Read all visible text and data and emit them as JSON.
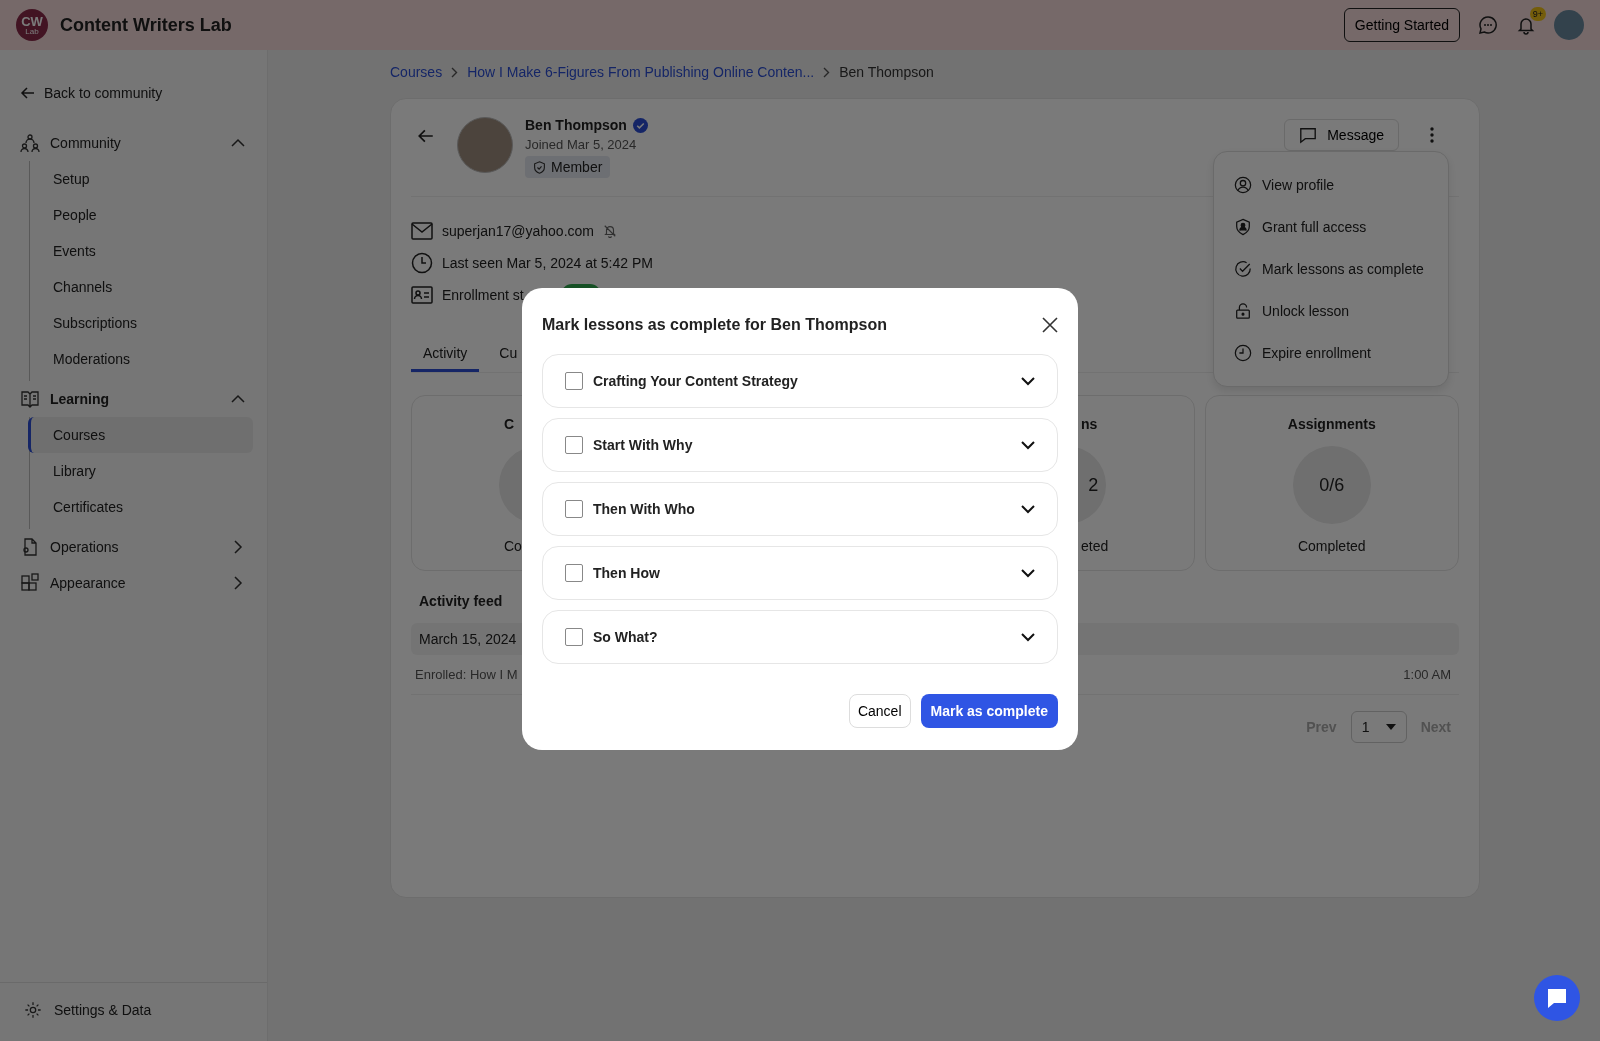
{
  "topbar": {
    "logo_initials": "CW",
    "logo_sub": "Lab",
    "brand": "Content Writers Lab",
    "getting_started": "Getting Started",
    "notification_badge": "9+"
  },
  "sidebar": {
    "back": "Back to community",
    "sections": [
      {
        "label": "Community",
        "active": false,
        "expanded": true,
        "children": [
          {
            "label": "Setup",
            "selected": false
          },
          {
            "label": "People",
            "selected": false
          },
          {
            "label": "Events",
            "selected": false
          },
          {
            "label": "Channels",
            "selected": false
          },
          {
            "label": "Subscriptions",
            "selected": false
          },
          {
            "label": "Moderations",
            "selected": false
          }
        ]
      },
      {
        "label": "Learning",
        "active": true,
        "expanded": true,
        "children": [
          {
            "label": "Courses",
            "selected": true
          },
          {
            "label": "Library",
            "selected": false
          },
          {
            "label": "Certificates",
            "selected": false
          }
        ]
      },
      {
        "label": "Operations",
        "active": false,
        "expanded": false
      },
      {
        "label": "Appearance",
        "active": false,
        "expanded": false
      }
    ],
    "footer": "Settings & Data"
  },
  "breadcrumb": [
    {
      "label": "Courses",
      "current": false
    },
    {
      "label": "How I Make 6-Figures From Publishing Online Conten...",
      "current": false
    },
    {
      "label": "Ben Thompson",
      "current": true
    }
  ],
  "profile": {
    "name": "Ben Thompson",
    "verified": true,
    "joined": "Joined Mar 5, 2024",
    "role": "Member",
    "message": "Message",
    "email": "superjan17@yahoo.com",
    "last_seen": "Last seen Mar 5, 2024 at 5:42 PM",
    "enrollment_label": "Enrollment st"
  },
  "menu": {
    "items": [
      "View profile",
      "Grant full access",
      "Mark lessons as complete",
      "Unlock lesson",
      "Expire enrollment"
    ]
  },
  "tabs": [
    {
      "label": "Activity",
      "selected": true
    },
    {
      "label": "Cu",
      "selected": false
    }
  ],
  "stats": [
    {
      "title": "C",
      "caption": "Co"
    },
    {
      "title": "ns",
      "value": "2",
      "caption": "eted"
    },
    {
      "title": "Assignments",
      "value": "0/6",
      "caption": "Completed"
    }
  ],
  "activity": {
    "heading": "Activity feed",
    "date": "March 15, 2024",
    "rows": [
      {
        "text": "Enrolled: How I M",
        "time": "1:00 AM"
      }
    ]
  },
  "pagination": {
    "prev": "Prev",
    "prev_disabled": true,
    "page": "1",
    "next": "Next",
    "next_disabled": true
  },
  "modal": {
    "title": "Mark lessons as complete for Ben Thompson",
    "lessons": [
      {
        "label": "Crafting Your Content Strategy",
        "checked": false
      },
      {
        "label": "Start With Why",
        "checked": false
      },
      {
        "label": "Then With Who",
        "checked": false
      },
      {
        "label": "Then How",
        "checked": false
      },
      {
        "label": "So What?",
        "checked": false
      }
    ],
    "cancel": "Cancel",
    "confirm": "Mark as complete"
  }
}
